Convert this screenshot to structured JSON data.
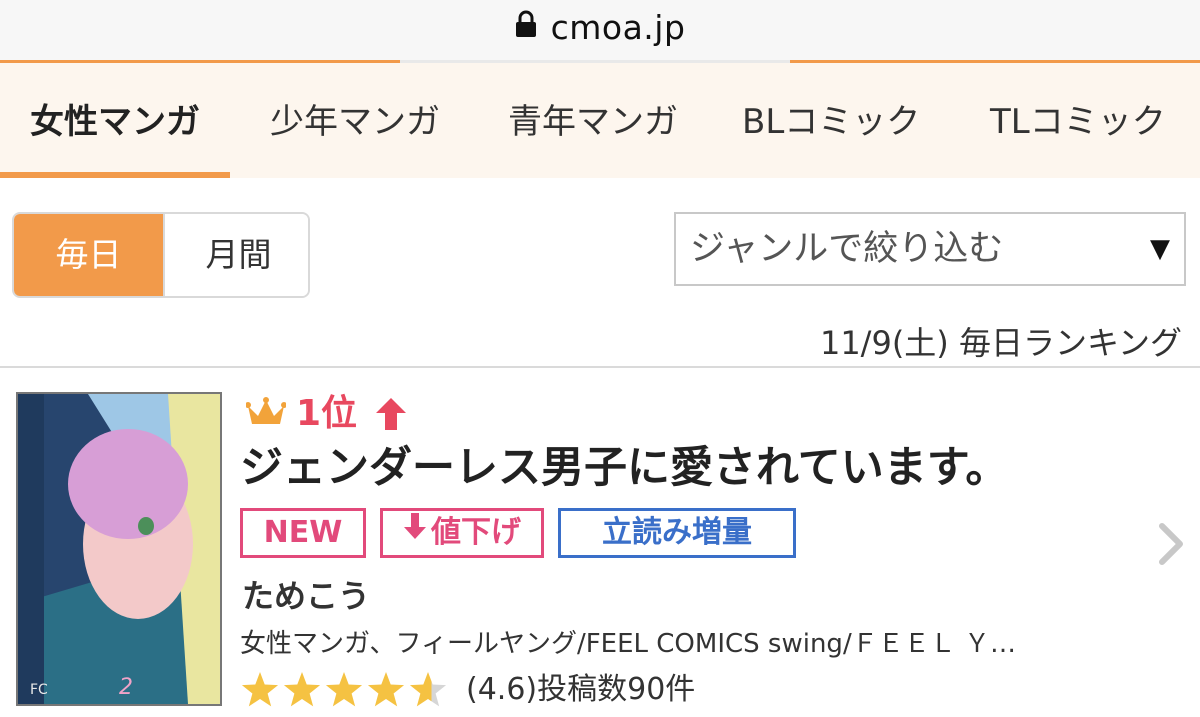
{
  "browser": {
    "domain": "cmoa.jp",
    "lock_icon": "lock-icon"
  },
  "category_tabs": [
    {
      "label": "女性マンガ",
      "active": true
    },
    {
      "label": "少年マンガ",
      "active": false
    },
    {
      "label": "青年マンガ",
      "active": false
    },
    {
      "label": "BLコミック",
      "active": false
    },
    {
      "label": "TLコミック",
      "active": false
    }
  ],
  "period_toggle": {
    "daily": "毎日",
    "monthly": "月間",
    "selected": "daily"
  },
  "genre_filter": {
    "label": "ジャンルで絞り込む",
    "arrow": "▼"
  },
  "ranking_header": "11/9(土) 毎日ランキング",
  "item": {
    "rank": "1位",
    "rank_trend": "up",
    "title": "ジェンダーレス男子に愛されています。",
    "badges": {
      "new": "NEW",
      "price_down": "値下げ",
      "trial": "立読み増量"
    },
    "author": "ためこう",
    "genres": "女性マンガ、フィールヤング/FEEL COMICS swing/ＦＥＥＬ Ｙ…",
    "rating_value": 4.6,
    "rating_text": "(4.6)投稿数90件"
  },
  "colors": {
    "accent": "#f29a4a",
    "rank_red": "#e8485f",
    "badge_pink": "#e24a7b",
    "badge_blue": "#3a6fc9",
    "star": "#f5c242"
  }
}
